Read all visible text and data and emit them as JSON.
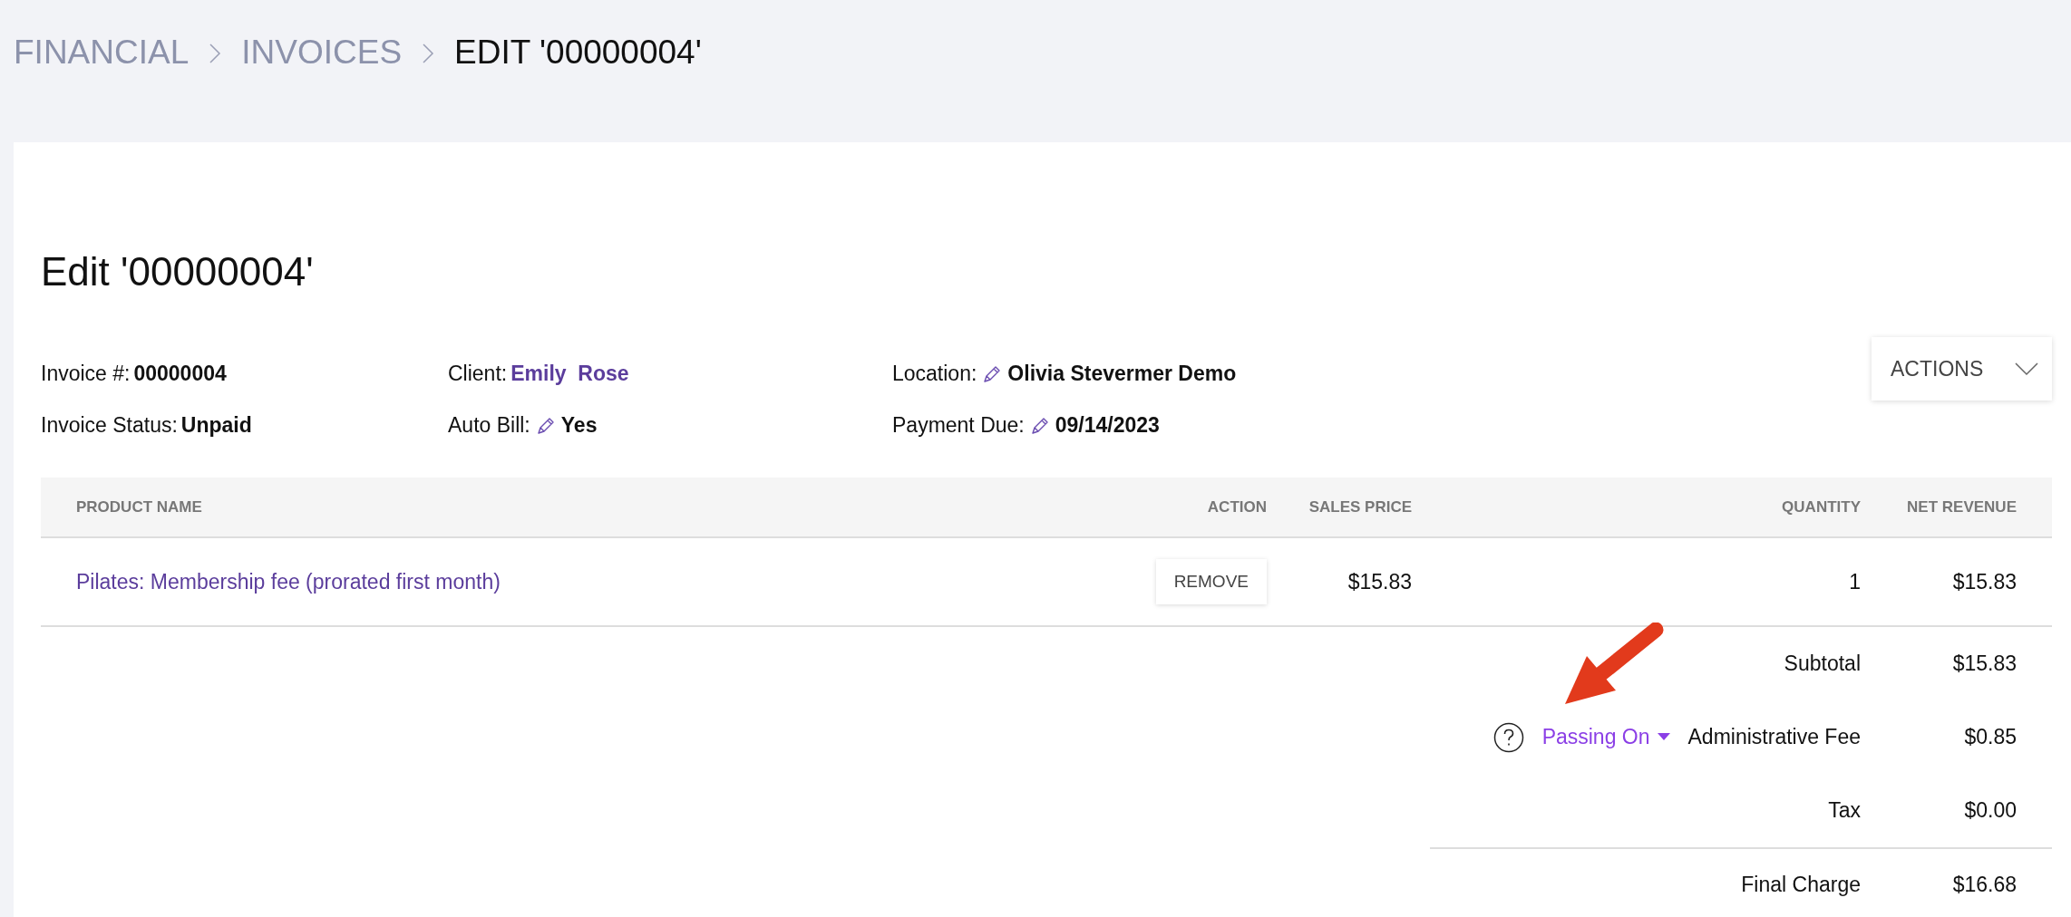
{
  "breadcrumb": [
    {
      "label": "FINANCIAL",
      "current": false
    },
    {
      "label": "INVOICES",
      "current": false
    },
    {
      "label": "EDIT '00000004'",
      "current": true
    }
  ],
  "title": "Edit '00000004'",
  "fields": [
    {
      "label": "Invoice #:",
      "value": "00000004",
      "kind": "text",
      "editable": false
    },
    {
      "label": "Client:",
      "value": "Emily  Rose",
      "kind": "link",
      "editable": false
    },
    {
      "label": "Location:",
      "value": "Olivia Stevermer Demo",
      "kind": "text",
      "editable": true
    },
    {
      "label": "Invoice Status:",
      "value": "Unpaid",
      "kind": "text",
      "editable": false
    },
    {
      "label": "Auto Bill:",
      "value": "Yes",
      "kind": "text",
      "editable": true
    },
    {
      "label": "Payment Due:",
      "value": "09/14/2023",
      "kind": "text",
      "editable": true
    }
  ],
  "actions_button": "ACTIONS",
  "table": {
    "columns": [
      "PRODUCT NAME",
      "ACTION",
      "SALES PRICE",
      "QUANTITY",
      "NET REVENUE"
    ],
    "rows": [
      {
        "product": "Pilates: Membership fee (prorated first month)",
        "action": "REMOVE",
        "sales_price": "$15.83",
        "quantity": "1",
        "net_revenue": "$15.83"
      }
    ]
  },
  "summary": [
    {
      "label": "Subtotal",
      "value": "$15.83",
      "help": false
    },
    {
      "label": "Administrative Fee",
      "value": "$0.85",
      "help": true,
      "mode": "Passing On"
    },
    {
      "label": "Tax",
      "value": "$0.00",
      "help": false
    }
  ],
  "final_charge": {
    "label": "Final Charge",
    "value": "$16.68"
  }
}
